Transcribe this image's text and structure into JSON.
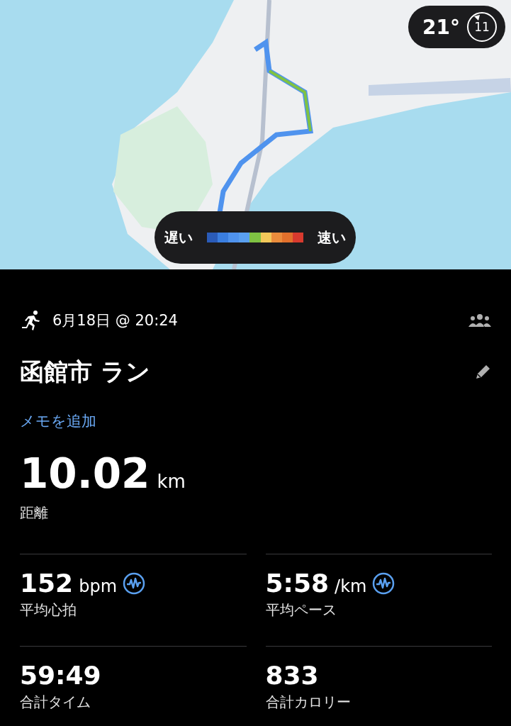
{
  "map": {
    "weather": {
      "temperature": "21°",
      "badge": "11"
    },
    "legend": {
      "slow": "遅い",
      "fast": "速い",
      "segments": [
        {
          "color": "#2a5bb8"
        },
        {
          "color": "#3a7ee0"
        },
        {
          "color": "#4f93ee"
        },
        {
          "color": "#5aa0f0"
        },
        {
          "color": "#7fc243"
        },
        {
          "color": "#f2c85a"
        },
        {
          "color": "#ea8c3c"
        },
        {
          "color": "#e2702c"
        },
        {
          "color": "#d83a2e"
        }
      ]
    }
  },
  "activity": {
    "date": "6月18日 @ 20:24",
    "title": "函館市 ラン",
    "add_note": "メモを追加",
    "distance": {
      "value": "10.02",
      "unit": "km",
      "label": "距離"
    },
    "stats": [
      {
        "value": "152",
        "unit": "bpm",
        "label": "平均心拍",
        "chart_link": true
      },
      {
        "value": "5:58",
        "unit": "/km",
        "label": "平均ペース",
        "chart_link": true
      },
      {
        "value": "59:49",
        "label": "合計タイム",
        "chart_link": false
      },
      {
        "value": "833",
        "label": "合計カロリー",
        "chart_link": false
      }
    ]
  }
}
